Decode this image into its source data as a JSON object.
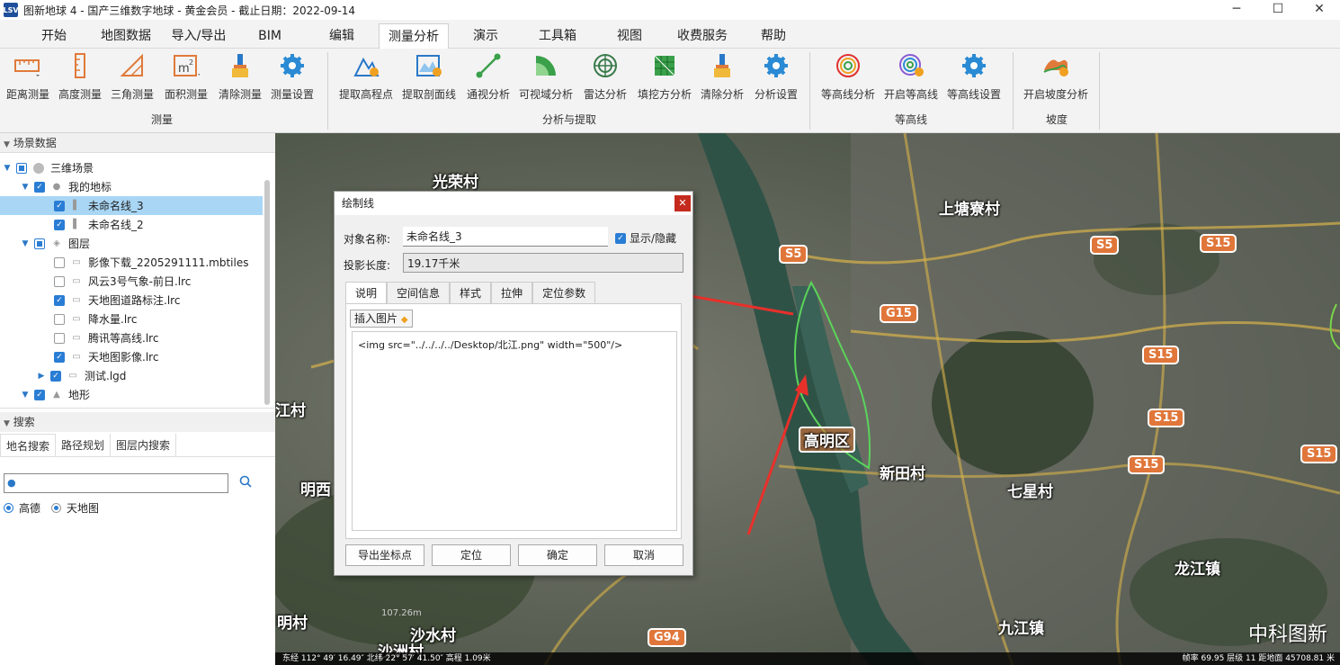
{
  "window": {
    "title": "图新地球 4 - 国产三维数字地球 - 黄金会员 - 截止日期：2022-09-14",
    "logo": "LSV"
  },
  "menu": [
    "开始",
    "地图数据",
    "导入/导出",
    "BIM",
    "编辑",
    "测量分析",
    "演示",
    "工具箱",
    "视图",
    "收费服务",
    "帮助"
  ],
  "ribbon": {
    "measure": {
      "label": "测量",
      "buttons": [
        "距离测量",
        "高度测量",
        "三角测量",
        "面积测量",
        "清除测量",
        "测量设置"
      ]
    },
    "analysis": {
      "label": "分析与提取",
      "buttons": [
        "提取高程点",
        "提取剖面线",
        "通视分析",
        "可视域分析",
        "雷达分析",
        "填挖方分析",
        "清除分析",
        "分析设置"
      ]
    },
    "contour": {
      "label": "等高线",
      "buttons": [
        "等高线分析",
        "开启等高线",
        "等高线设置"
      ]
    },
    "slope": {
      "label": "坡度",
      "buttons": [
        "开启坡度分析"
      ]
    }
  },
  "scene": {
    "header": "场景数据",
    "items": [
      {
        "label": "三维场景"
      },
      {
        "label": "我的地标"
      },
      {
        "label": "未命名线_3"
      },
      {
        "label": "未命名线_2"
      },
      {
        "label": "图层"
      },
      {
        "label": "影像下载_2205291111.mbtiles"
      },
      {
        "label": "风云3号气象-前日.lrc"
      },
      {
        "label": "天地图道路标注.lrc"
      },
      {
        "label": "降水量.lrc"
      },
      {
        "label": "腾讯等高线.lrc"
      },
      {
        "label": "天地图影像.lrc"
      },
      {
        "label": "测试.lgd"
      },
      {
        "label": "地形"
      }
    ]
  },
  "search": {
    "header": "搜索",
    "tabs": [
      "地名搜索",
      "路径规划",
      "图层内搜索"
    ],
    "value": "",
    "radios": [
      "高德",
      "天地图"
    ]
  },
  "map": {
    "labels": [
      "光荣村",
      "上塘寮村",
      "高明区",
      "新田村",
      "七星村",
      "龙江镇",
      "九江镇",
      "沙水村",
      "明西",
      "明村",
      "江村",
      "沙洲村"
    ],
    "shields": [
      "S5",
      "S5",
      "S15",
      "G15",
      "S15",
      "S15",
      "S15",
      "G94",
      "S15"
    ],
    "coord_readout": "107.26m",
    "status_left": "东经 112° 49′ 16.49″ 北纬 22° 57′ 41.50″ 高程 1.09米",
    "status_right": "帧率 69.95  层级 11  距地面 45708.81 米",
    "watermark": "中科图新"
  },
  "dialog": {
    "title": "绘制线",
    "name_label": "对象名称:",
    "name_value": "未命名线_3",
    "show_hide": "显示/隐藏",
    "length_label": "投影长度:",
    "length_value": "19.17千米",
    "tabs": [
      "说明",
      "空间信息",
      "样式",
      "拉伸",
      "定位参数"
    ],
    "insert_image": "插入图片",
    "content": "<img src=\"../../../../Desktop/北江.png\" width=\"500\"/>",
    "buttons": [
      "导出坐标点",
      "定位",
      "确定",
      "取消"
    ]
  }
}
